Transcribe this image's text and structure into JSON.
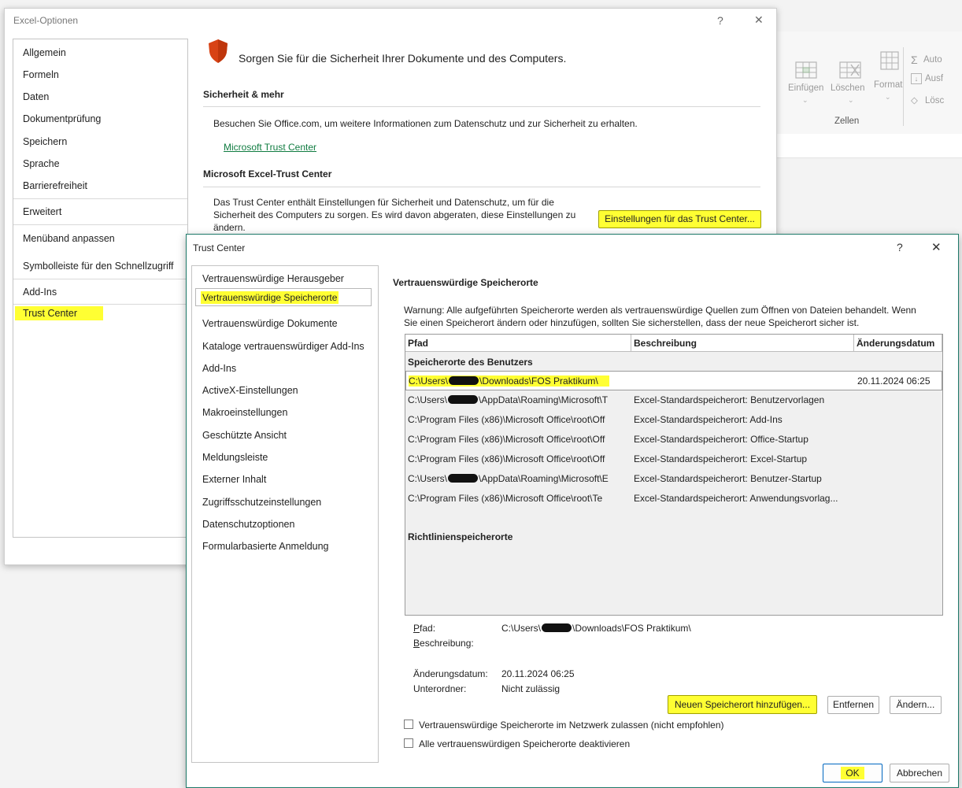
{
  "ribbon": {
    "insert_label": "Einfügen",
    "delete_label": "Löschen",
    "format_label": "Format",
    "group_label": "Zellen",
    "autosum_label": "Auto",
    "fill_label": "Ausf",
    "clear_label": "Lösc"
  },
  "options_dialog": {
    "title": "Excel-Optionen",
    "help": "?",
    "close": "✕",
    "nav": [
      {
        "label": "Allgemein"
      },
      {
        "label": "Formeln"
      },
      {
        "label": "Daten"
      },
      {
        "label": "Dokumentprüfung"
      },
      {
        "label": "Speichern"
      },
      {
        "label": "Sprache"
      },
      {
        "label": "Barrierefreiheit"
      },
      {
        "label": "Erweitert"
      },
      {
        "label": "Menüband anpassen"
      },
      {
        "label": "Symbolleiste für den Schnellzugriff"
      },
      {
        "label": "Add-Ins"
      },
      {
        "label": "Trust Center"
      }
    ],
    "heading": "Sorgen Sie für die Sicherheit Ihrer Dokumente und des Computers.",
    "section1_title": "Sicherheit & mehr",
    "section1_text": "Besuchen Sie Office.com, um weitere Informationen zum Datenschutz und zur Sicherheit zu erhalten.",
    "trust_center_link": "Microsoft Trust Center",
    "section2_title": "Microsoft Excel-Trust Center",
    "section2_text_l1": "Das Trust Center enthält Einstellungen für Sicherheit und Datenschutz, um für die",
    "section2_text_l2": "Sicherheit des Computers zu sorgen. Es wird davon abgeraten, diese Einstellungen zu",
    "section2_text_l3": "ändern.",
    "settings_button": "Einstellungen für das Trust Center..."
  },
  "trust_center": {
    "title": "Trust Center",
    "help": "?",
    "close": "✕",
    "nav": [
      {
        "label": "Vertrauenswürdige Herausgeber"
      },
      {
        "label": "Vertrauenswürdige Speicherorte"
      },
      {
        "label": "Vertrauenswürdige Dokumente"
      },
      {
        "label": "Kataloge vertrauenswürdiger Add-Ins"
      },
      {
        "label": "Add-Ins"
      },
      {
        "label": "ActiveX-Einstellungen"
      },
      {
        "label": "Makroeinstellungen"
      },
      {
        "label": "Geschützte Ansicht"
      },
      {
        "label": "Meldungsleiste"
      },
      {
        "label": "Externer Inhalt"
      },
      {
        "label": "Zugriffsschutzeinstellungen"
      },
      {
        "label": "Datenschutzoptionen"
      },
      {
        "label": "Formularbasierte Anmeldung"
      }
    ],
    "page_title": "Vertrauenswürdige Speicherorte",
    "warning_l1": "Warnung: Alle aufgeführten Speicherorte werden als vertrauenswürdige Quellen zum Öffnen von Dateien behandelt. Wenn",
    "warning_l2": "Sie einen Speicherort ändern oder hinzufügen, sollten Sie sicherstellen, dass der neue Speicherort sicher ist.",
    "columns": {
      "path": "Pfad",
      "description": "Beschreibung",
      "date": "Änderungsdatum"
    },
    "user_group": "Speicherorte des Benutzers",
    "rows": [
      {
        "p1": "C:\\Users\\",
        "p2": "\\Downloads\\FOS Praktikum\\",
        "desc": "",
        "date": "20.11.2024 06:25"
      },
      {
        "p1": "C:\\Users\\",
        "p2": "\\AppData\\Roaming\\Microsoft\\T",
        "desc": "Excel-Standardspeicherort: Benutzervorlagen",
        "date": ""
      },
      {
        "p1": "C:\\Program Files (x86)\\Microsoft Office\\root\\Off",
        "p2": "",
        "desc": "Excel-Standardspeicherort: Add-Ins",
        "date": ""
      },
      {
        "p1": "C:\\Program Files (x86)\\Microsoft Office\\root\\Off",
        "p2": "",
        "desc": "Excel-Standardspeicherort: Office-Startup",
        "date": ""
      },
      {
        "p1": "C:\\Program Files (x86)\\Microsoft Office\\root\\Off",
        "p2": "",
        "desc": "Excel-Standardspeicherort: Excel-Startup",
        "date": ""
      },
      {
        "p1": "C:\\Users\\",
        "p2": "\\AppData\\Roaming\\Microsoft\\E",
        "desc": "Excel-Standardspeicherort: Benutzer-Startup",
        "date": ""
      },
      {
        "p1": "C:\\Program Files (x86)\\Microsoft Office\\root\\Te",
        "p2": "",
        "desc": "Excel-Standardspeicherort: Anwendungsvorlag...",
        "date": ""
      }
    ],
    "policy_group": "Richtlinienspeicherorte",
    "detail": {
      "path_label": "Pfad:",
      "path_value_a": "C:\\Users\\",
      "path_value_b": "\\Downloads\\FOS Praktikum\\",
      "desc_label": "Beschreibung:",
      "date_label": "Änderungsdatum:",
      "date_value": "20.11.2024 06:25",
      "sub_label": "Unterordner:",
      "sub_value": "Nicht zulässig"
    },
    "add_button": "Neuen Speicherort hinzufügen...",
    "remove_button": "Entfernen",
    "modify_button": "Ändern...",
    "network_checkbox": "Vertrauenswürdige Speicherorte im Netzwerk zulassen (nicht empfohlen)",
    "disable_checkbox": "Alle vertrauenswürdigen Speicherorte deaktivieren",
    "ok_button": "OK",
    "cancel_button": "Abbrechen"
  }
}
